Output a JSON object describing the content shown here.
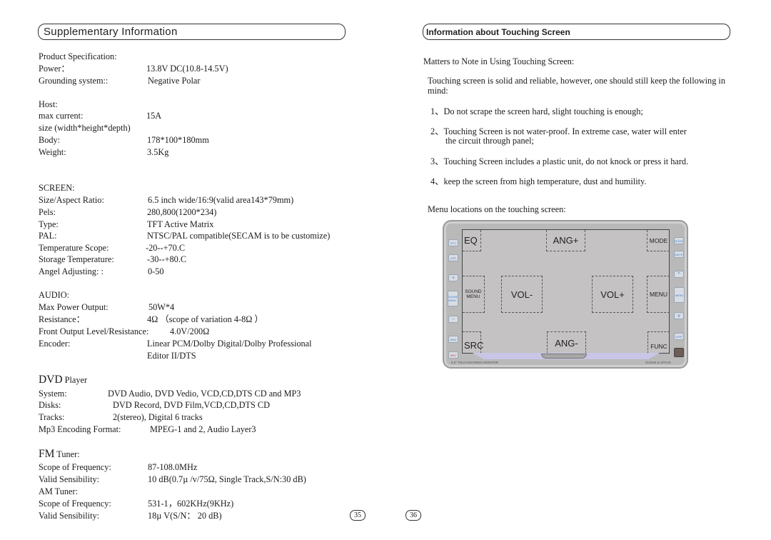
{
  "left_page": {
    "header": "Supplementary Information",
    "product_spec": {
      "title": "Product Specification:",
      "rows": [
        {
          "label": "Power：",
          "value": "13.8V DC(10.8-14.5V)"
        },
        {
          "label": "Grounding system::",
          "value": "Negative Polar"
        }
      ]
    },
    "host": {
      "title": "Host:",
      "rows": [
        {
          "label": "max current:",
          "value": "15A"
        },
        {
          "label": "size (width*height*depth)",
          "value": ""
        },
        {
          "label": "Body:",
          "value": "178*100*180mm"
        },
        {
          "label": "Weight:",
          "value": "3.5Kg"
        }
      ]
    },
    "screen": {
      "title": "SCREEN:",
      "rows": [
        {
          "label": "Size/Aspect Ratio:",
          "value": "6.5 inch wide/16:9(valid area143*79mm)"
        },
        {
          "label": "Pels:",
          "value": "280,800(1200*234)"
        },
        {
          "label": "Type:",
          "value": "TFT Active Matrix"
        },
        {
          "label": "PAL:",
          "value": "NTSC/PAL compatible(SECAM is to be customize)"
        },
        {
          "label": "Temperature Scope:",
          "value": "-20--+70.C"
        },
        {
          "label": "Storage Temperature:",
          "value": "-30--+80.C"
        },
        {
          "label": "Angel Adjusting:  :",
          "value": "0-50"
        }
      ]
    },
    "audio": {
      "title": "AUDIO:",
      "rows": [
        {
          "label": "Max Power Output:",
          "value": "50W*4"
        },
        {
          "label": "Resistance：",
          "value": "4Ω （scope of variation 4-8Ω ）"
        },
        {
          "label": "Front Output Level/Resistance:",
          "value": "4.0V/200Ω"
        },
        {
          "label": "Encoder:",
          "value": "Linear PCM/Dolby Digital/Dolby Professional"
        },
        {
          "label": "",
          "value": "Editor II/DTS"
        }
      ]
    },
    "dvd": {
      "title_big": "DVD",
      "title_small": "Player",
      "rows": [
        {
          "label": "System:",
          "value": "DVD Audio, DVD Vedio, VCD,CD,DTS CD and MP3"
        },
        {
          "label": "Disks:",
          "value": "DVD Record, DVD Film,VCD,CD,DTS CD"
        },
        {
          "label": "Tracks:",
          "value": "2(stereo), Digital 6 tracks"
        },
        {
          "label": "Mp3 Encoding Format:",
          "value": "MPEG-1 and 2, Audio Layer3"
        }
      ]
    },
    "fm": {
      "title_big": "FM",
      "title_small": "Tuner:",
      "rows": [
        {
          "label": "Scope of Frequency:",
          "value": "87-108.0MHz"
        },
        {
          "label": "Valid Sensibility:",
          "value": "10 dB(0.7µ /v/75Ω, Single Track,S/N:30 dB)"
        }
      ]
    },
    "am": {
      "title": "AM Tuner:",
      "rows": [
        {
          "label": "Scope of Frequency:",
          "value": "531-1，602KHz(9KHz)"
        },
        {
          "label": "Valid Sensibility:",
          "value": "18µ V(S/N： 20 dB)"
        }
      ]
    },
    "page_number": "35"
  },
  "right_page": {
    "header": "Information about Touching Screen",
    "intro": "Matters to Note in Using Touching Screen:",
    "lead": "Touching screen is solid and reliable, however, one should still keep the following in mind:",
    "notes": [
      {
        "num": "1、",
        "text": "Do not scrape the screen hard, slight touching is enough;"
      },
      {
        "num": "2、",
        "text": "Touching Screen is not water-proof. In extreme case, water will enter",
        "text2": "the circuit through panel;"
      },
      {
        "num": "3、",
        "text": "Touching Screen includes a plastic unit, do not knock or press it hard."
      },
      {
        "num": "4、",
        "text": "keep the screen from high temperature, dust and humility."
      }
    ],
    "menu_caption": "Menu locations on the touching screen:",
    "touch_zones": {
      "eq": "EQ",
      "ang_plus": "ANG+",
      "mode": "MODE",
      "sound_menu_1": "SOUND",
      "sound_menu_2": "MENU",
      "vol_minus": "VOL-",
      "vol_plus": "VOL+",
      "menu": "MENU",
      "src": "SRC",
      "ang_minus": "ANG-",
      "func": "FUNC"
    },
    "left_buttons": [
      "ETC",
      "LIST",
      "+",
      "SOUND MENU",
      "−",
      "ANG",
      "SRC"
    ],
    "right_buttons": [
      "MODE",
      "MUTE",
      "^",
      "MENU",
      "v",
      "DISP"
    ],
    "device_caption_left": "6.5\" TOUCHSCREEN MONITOR",
    "device_caption_right": "SCENE & SPACE",
    "page_number": "36"
  },
  "colors": {
    "text": "#1a1a1a",
    "device_body": "#b9b9b9",
    "screen": "#c4c2c2",
    "button_label": "#3d7fd0",
    "src_button_label": "#d03030",
    "bottom_bar": "#c9c5e6"
  }
}
